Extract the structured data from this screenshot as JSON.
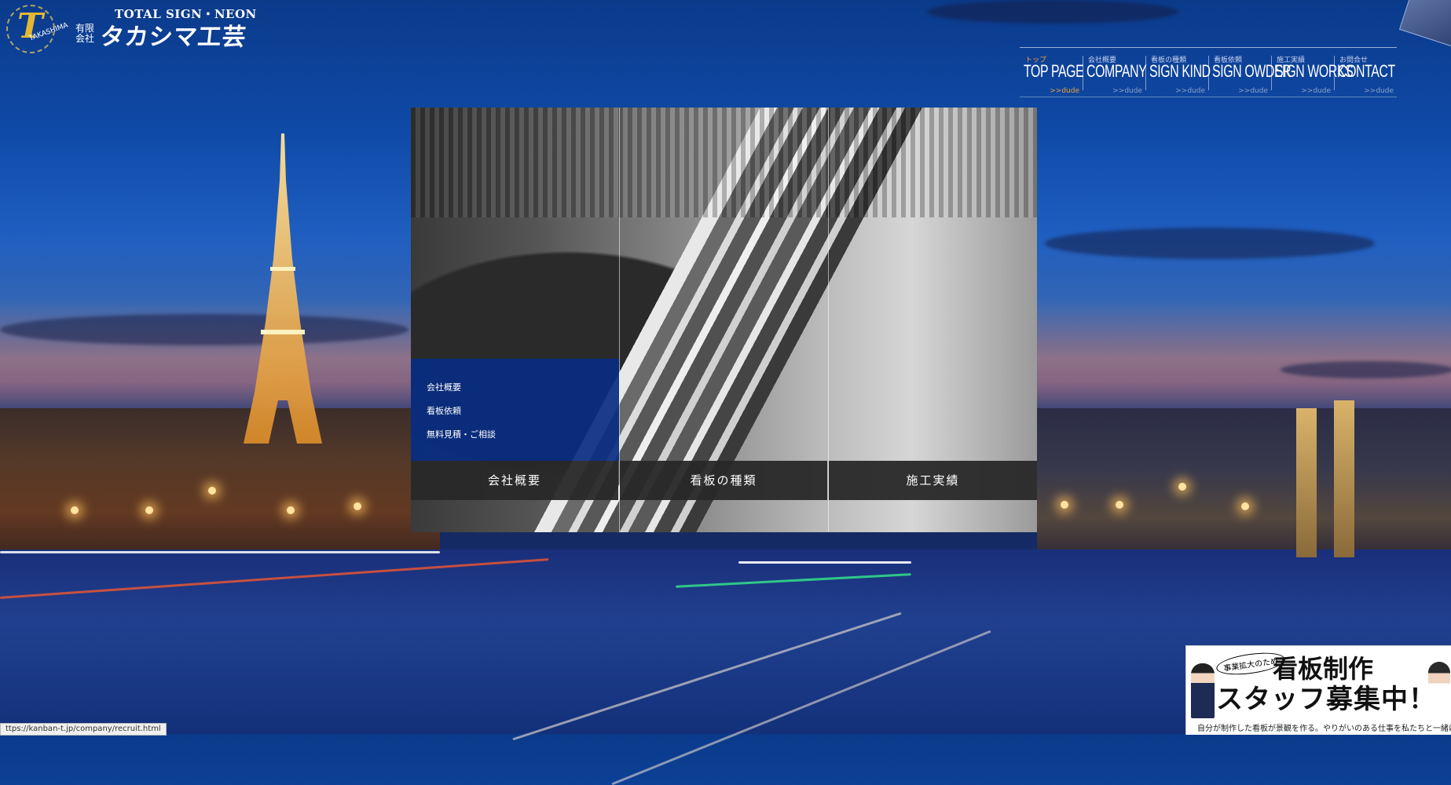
{
  "header": {
    "tagline": "TOTAL SIGN・NEON",
    "company_type": "有限会社",
    "company_name": "タカシマ工芸",
    "logo_letter": "T",
    "logo_text": "TAKASHIMA"
  },
  "nav": {
    "items": [
      {
        "jp": "トップ",
        "en": "TOP PAGE",
        "more": ">>dude",
        "active": true
      },
      {
        "jp": "会社概要",
        "en": "COMPANY",
        "more": ">>dude"
      },
      {
        "jp": "看板の種類",
        "en": "SIGN KIND",
        "more": ">>dude"
      },
      {
        "jp": "看板依頼",
        "en": "SIGN OWDER",
        "more": ">>dude"
      },
      {
        "jp": "施工実績",
        "en": "SIGN WORKS",
        "more": ">>dude"
      },
      {
        "jp": "お問合せ",
        "en": "CONTACT",
        "more": ">>dude"
      }
    ]
  },
  "panel": {
    "sub_menu": [
      "会社概要",
      "看板依頼",
      "無料見積・ご相談"
    ],
    "labels": [
      "会社概要",
      "看板の種類",
      "施工実績"
    ]
  },
  "recruit": {
    "bubble": "事業拡大のため",
    "line1": "看板制作",
    "line2": "スタッフ募集中！",
    "caption": "自分が制作した看板が景観を作る。やりがいのある仕事を私たちと一緒に！"
  },
  "status_bar": "ttps://kanban-t.jp/company/recruit.html",
  "colors": {
    "accent": "#f0a030",
    "submenu_bg": "#082d82",
    "label_bar_bg": "#282828"
  }
}
